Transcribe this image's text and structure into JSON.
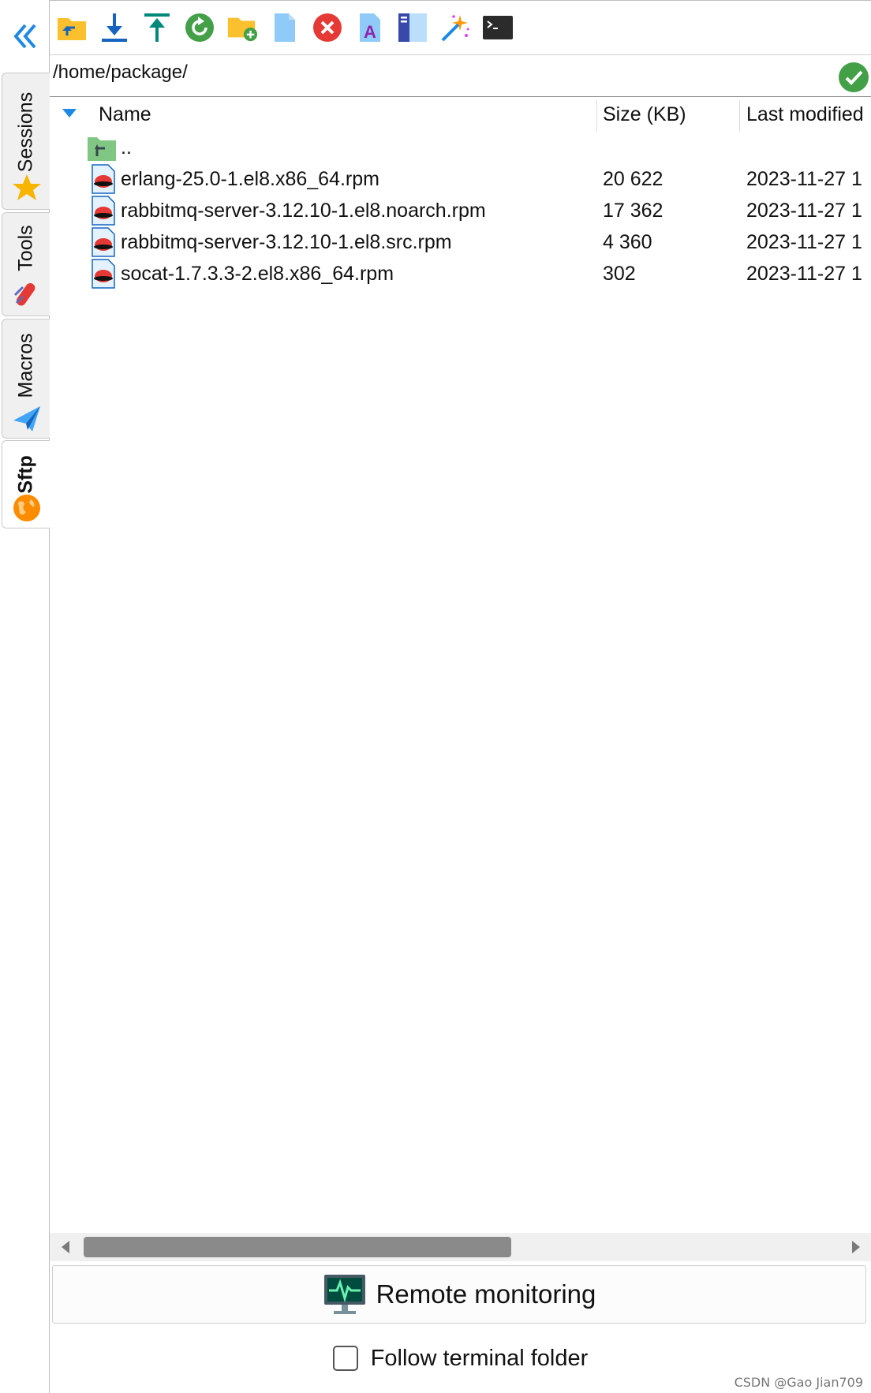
{
  "sidebar": {
    "collapse_icon": "double-chevron-left-icon",
    "tabs": [
      {
        "label": "Sessions",
        "icon": "star-icon",
        "active": false
      },
      {
        "label": "Tools",
        "icon": "swiss-knife-icon",
        "active": false
      },
      {
        "label": "Macros",
        "icon": "paper-plane-icon",
        "active": false
      },
      {
        "label": "Sftp",
        "icon": "globe-icon",
        "active": true
      }
    ]
  },
  "toolbar": {
    "buttons": [
      "parent-folder-icon",
      "download-icon",
      "upload-icon",
      "refresh-icon",
      "new-folder-icon",
      "new-file-icon",
      "delete-icon",
      "rename-icon",
      "properties-icon",
      "magic-wand-icon",
      "terminal-icon"
    ]
  },
  "pathbar": {
    "path": "/home/package/",
    "ok_icon": "check-circle-icon"
  },
  "columns": {
    "name": "Name",
    "size": "Size (KB)",
    "modified": "Last modified"
  },
  "files": [
    {
      "name": "..",
      "size": "",
      "modified": "",
      "icon": "parent-folder-icon"
    },
    {
      "name": "erlang-25.0-1.el8.x86_64.rpm",
      "size": "20 622",
      "modified": "2023-11-27 1",
      "icon": "rpm-file-icon"
    },
    {
      "name": "rabbitmq-server-3.12.10-1.el8.noarch.rpm",
      "size": "17 362",
      "modified": "2023-11-27 1",
      "icon": "rpm-file-icon"
    },
    {
      "name": "rabbitmq-server-3.12.10-1.el8.src.rpm",
      "size": "4 360",
      "modified": "2023-11-27 1",
      "icon": "rpm-file-icon"
    },
    {
      "name": "socat-1.7.3.3-2.el8.x86_64.rpm",
      "size": "302",
      "modified": "2023-11-27 1",
      "icon": "rpm-file-icon"
    }
  ],
  "remote_monitoring": {
    "label": "Remote monitoring",
    "icon": "monitor-icon"
  },
  "follow_terminal": {
    "label": "Follow terminal folder",
    "checked": false
  },
  "watermark": "CSDN @Gao Jian709",
  "colors": {
    "accent": "#1e88e5",
    "ok_green": "#4caf50",
    "scroll_thumb": "#8a8a8a"
  }
}
